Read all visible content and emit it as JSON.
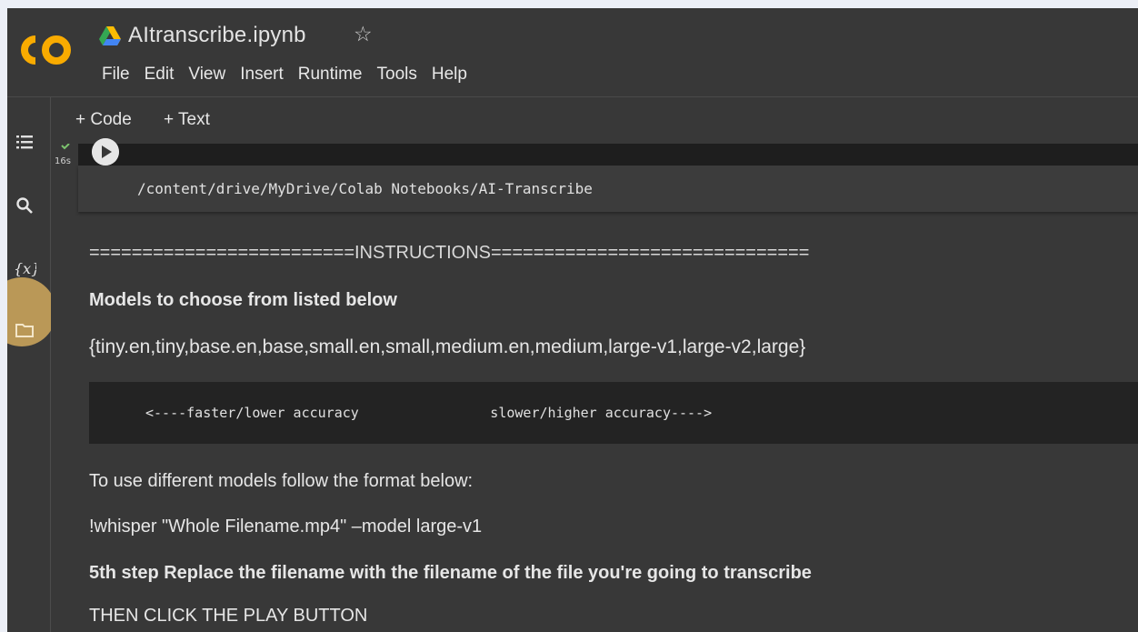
{
  "window": {
    "title": "AItranscribe.ipynb",
    "logo_text": "CO",
    "accent_orange": "#f9ab00",
    "highlight_color": "#c9a35b"
  },
  "menu": {
    "items": [
      "File",
      "Edit",
      "View",
      "Insert",
      "Runtime",
      "Tools",
      "Help"
    ]
  },
  "toolbar": {
    "add_code": "+ Code",
    "add_text": "+ Text"
  },
  "rail": {
    "icons": [
      "table-of-contents-icon",
      "search-icon",
      "variables-icon",
      "files-icon"
    ]
  },
  "cell": {
    "exec_time": "16s",
    "output": "/content/drive/MyDrive/Colab Notebooks/AI-Transcribe"
  },
  "markdown": {
    "instructions": "=========================INSTRUCTIONS==============================",
    "models_heading": "Models to choose from listed below",
    "models_list": "{tiny.en,tiny,base.en,base,small.en,small,medium.en,medium,large-v1,large-v2,large}",
    "code_block": "<----faster/lower accuracy                slower/higher accuracy---->",
    "format_text": "To use different models follow the format below:",
    "command_example": "!whisper \"Whole Filename.mp4\" –model large-v1",
    "step_five": "5th step Replace the filename with the filename of the file you're going to transcribe",
    "play_instruction": "THEN CLICK THE PLAY BUTTON"
  }
}
